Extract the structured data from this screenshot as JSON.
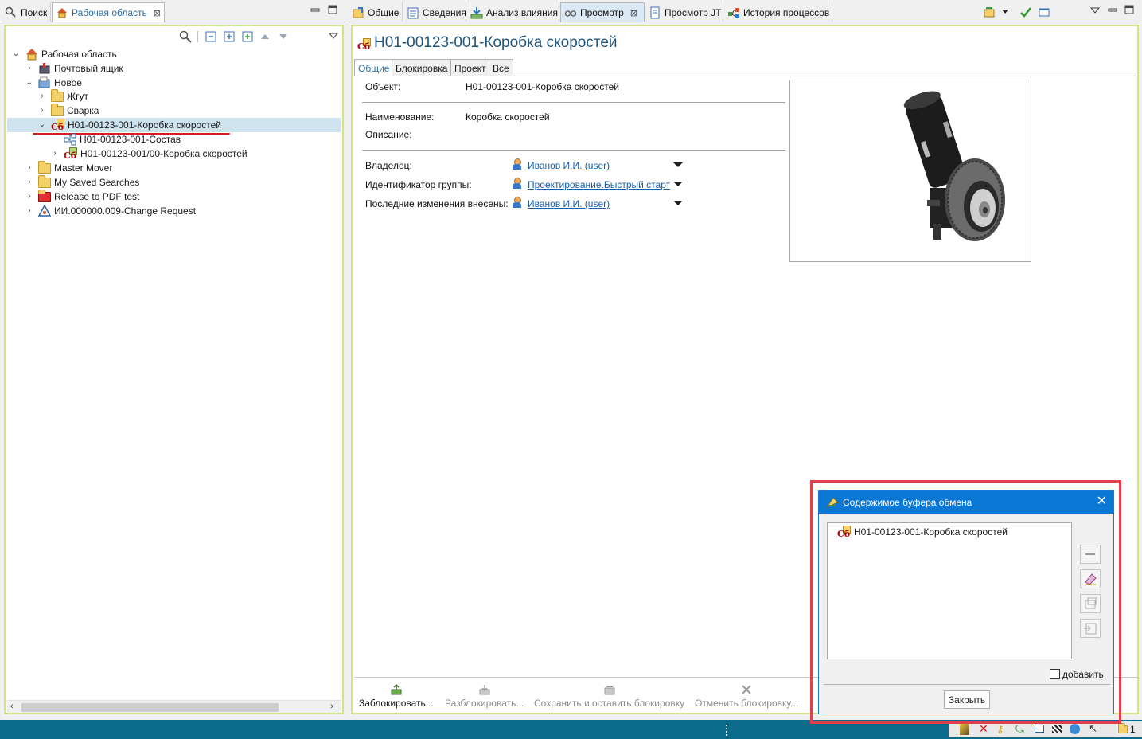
{
  "left_tabs": {
    "search": "Поиск",
    "workspace": "Рабочая область"
  },
  "right_tabs": [
    "Общие",
    "Сведения",
    "Анализ влияния",
    "Просмотр",
    "Просмотр JT",
    "История процессов"
  ],
  "tree": {
    "root": "Рабочая область",
    "mailbox": "Почтовый ящик",
    "new": "Новое",
    "zhgut": "Жгут",
    "svarka": "Сварка",
    "selected": "Н01-00123-001-Коробка скоростей",
    "child1": "Н01-00123-001-Состав",
    "child2": "Н01-00123-001/00-Коробка скоростей",
    "master_mover": "Master Mover",
    "saved_searches": "My Saved Searches",
    "release_pdf": "Release to PDF test",
    "change_request": "ИИ.000000.009-Change Request"
  },
  "badge_text": "Сб",
  "summary": {
    "title": "Н01-00123-001-Коробка скоростей",
    "subtabs": [
      "Общие",
      "Блокировка",
      "Проект",
      "Все"
    ],
    "object_label": "Объект:",
    "object_value": "Н01-00123-001-Коробка скоростей",
    "name_label": "Наименование:",
    "name_value": "Коробка скоростей",
    "desc_label": "Описание:",
    "owner_label": "Владелец:",
    "owner_value": "Иванов И.И. (user)",
    "group_label": "Идентификатор группы:",
    "group_value": "Проектирование.Быстрый старт",
    "last_mod_label": "Последние изменения внесены:",
    "last_mod_value": "Иванов И.И. (user)"
  },
  "bottom_toolbar": {
    "lock": "Заблокировать...",
    "unlock": "Разблокировать...",
    "save_keep": "Сохранить и оставить блокировку",
    "cancel_lock": "Отменить блокировку..."
  },
  "dialog": {
    "title": "Содержимое буфера обмена",
    "item": "Н01-00123-001-Коробка скоростей",
    "add_label": "добавить",
    "close_button": "Закрыть"
  },
  "status_tray": {
    "count": "1"
  },
  "colors": {
    "panel_border": "#cde882",
    "title_blue": "#20557e",
    "dialog_title_bar": "#0b78d6",
    "highlight_frame": "#e0404a",
    "selection": "#cfe3ef",
    "status_bar": "#0c6a8a"
  }
}
